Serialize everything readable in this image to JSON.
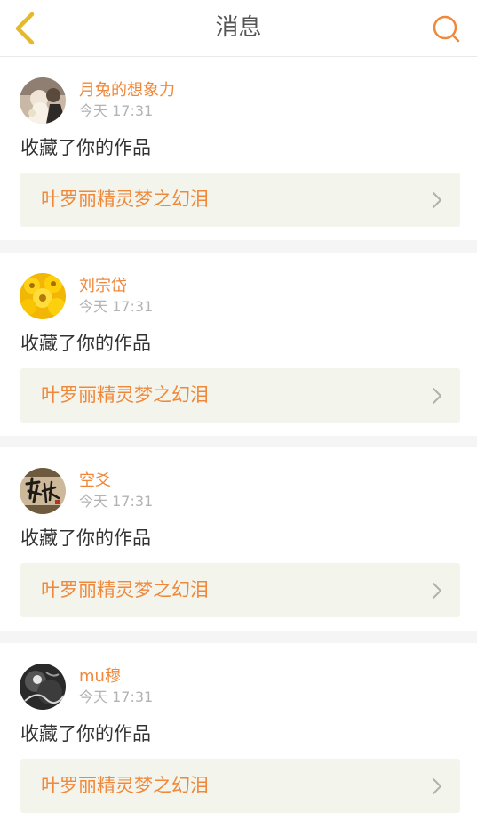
{
  "header": {
    "title": "消息",
    "back_icon": "chevron-left-icon",
    "search_icon": "search-icon",
    "accent_color": "#f0883c",
    "back_color": "#e5b82d"
  },
  "messages": [
    {
      "username": "月兔的想象力",
      "time": "今天 17:31",
      "action": "收藏了你的作品",
      "work_title": "叶罗丽精灵梦之幻泪",
      "avatar": "avatar-photo-bride"
    },
    {
      "username": "刘宗岱",
      "time": "今天 17:31",
      "action": "收藏了你的作品",
      "work_title": "叶罗丽精灵梦之幻泪",
      "avatar": "avatar-sunflower"
    },
    {
      "username": "空爻",
      "time": "今天 17:31",
      "action": "收藏了你的作品",
      "work_title": "叶罗丽精灵梦之幻泪",
      "avatar": "avatar-calligraphy"
    },
    {
      "username": "mu穆",
      "time": "今天 17:31",
      "action": "收藏了你的作品",
      "work_title": "叶罗丽精灵梦之幻泪",
      "avatar": "avatar-dark-ink"
    }
  ]
}
